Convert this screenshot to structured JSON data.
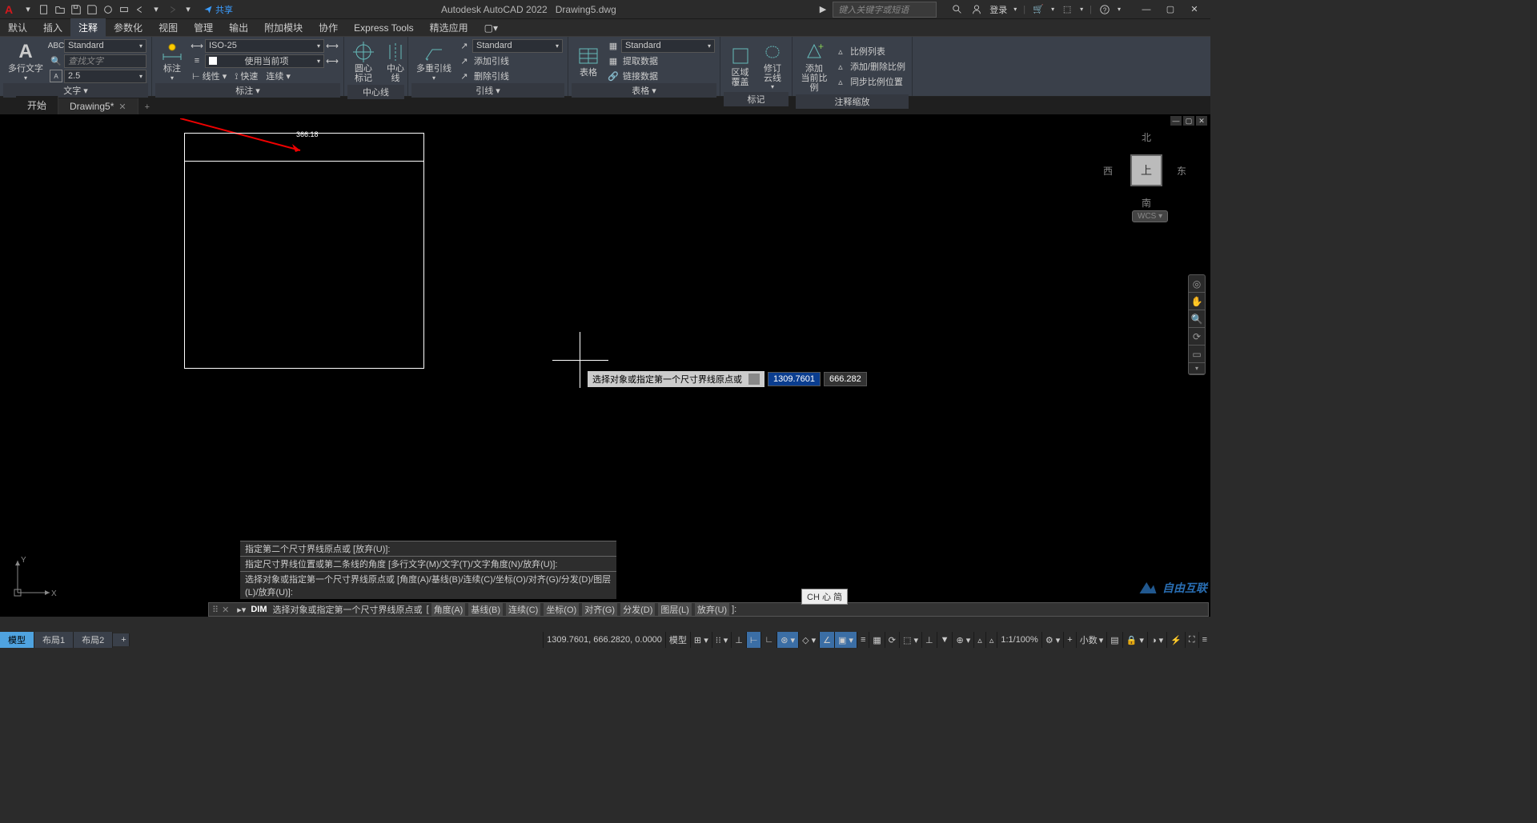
{
  "titlebar": {
    "app_title": "Autodesk AutoCAD 2022",
    "document": "Drawing5.dwg",
    "share": "共享",
    "search_placeholder": "键入关键字或短语",
    "login": "登录"
  },
  "menubar": {
    "items": [
      "默认",
      "插入",
      "注释",
      "参数化",
      "视图",
      "管理",
      "输出",
      "附加模块",
      "协作",
      "Express Tools",
      "精选应用"
    ],
    "active_index": 2
  },
  "ribbon": {
    "text_panel": {
      "big_button": "多行文字",
      "style_combo": "Standard",
      "find_placeholder": "查找文字",
      "height": "2.5",
      "title": "文字"
    },
    "dim_panel": {
      "big_button": "标注",
      "style_combo": "ISO-25",
      "layer_combo": "使用当前项",
      "linear": "线性",
      "quick": "快速",
      "continue": "连续",
      "title": "标注"
    },
    "centerline_panel": {
      "center_mark": "圆心\n标记",
      "centerline": "中心线",
      "title": "中心线"
    },
    "leader_panel": {
      "big_button": "多重引线",
      "style_combo": "Standard",
      "add": "添加引线",
      "remove": "删除引线",
      "title": "引线"
    },
    "table_panel": {
      "big_button": "表格",
      "style_combo": "Standard",
      "extract": "提取数据",
      "link": "链接数据",
      "title": "表格"
    },
    "markup_panel": {
      "wipeout": "区域覆盖",
      "revision": "修订\n云线",
      "title": "标记"
    },
    "anno_scale_panel": {
      "add": "添加\n当前比例",
      "scale_list": "比例列表",
      "add_del": "添加/删除比例",
      "sync": "同步比例位置",
      "title": "注释缩放"
    }
  },
  "filetabs": {
    "start": "开始",
    "current": "Drawing5*"
  },
  "drawing": {
    "dim_value": "366.18",
    "dyn_prompt": "选择对象或指定第一个尺寸界线原点或",
    "dyn_x": "1309.7601",
    "dyn_y": "666.282",
    "viewcube": {
      "n": "北",
      "s": "南",
      "e": "东",
      "w": "西",
      "top": "上",
      "wcs": "WCS"
    },
    "ucs": {
      "x": "X",
      "y": "Y"
    }
  },
  "cmdhistory": [
    "指定第二个尺寸界线原点或 [放弃(U)]:",
    "指定尺寸界线位置或第二条线的角度 [多行文字(M)/文字(T)/文字角度(N)/放弃(U)]:",
    "选择对象或指定第一个尺寸界线原点或 [角度(A)/基线(B)/连续(C)/坐标(O)/对齐(G)/分发(D)/图层(L)/放弃(U)]:"
  ],
  "cmdline": {
    "cmd": "DIM",
    "prompt": "选择对象或指定第一个尺寸界线原点或",
    "opts": [
      "角度(A)",
      "基线(B)",
      "连续(C)",
      "坐标(O)",
      "对齐(G)",
      "分发(D)",
      "图层(L)",
      "放弃(U)"
    ],
    "ime": "CH 心 简"
  },
  "statusbar": {
    "tabs": [
      "模型",
      "布局1",
      "布局2"
    ],
    "coords": "1309.7601, 666.2820, 0.0000",
    "model": "模型",
    "scale": "1:1/100%",
    "decimal": "小数"
  },
  "watermark": "自由互联"
}
